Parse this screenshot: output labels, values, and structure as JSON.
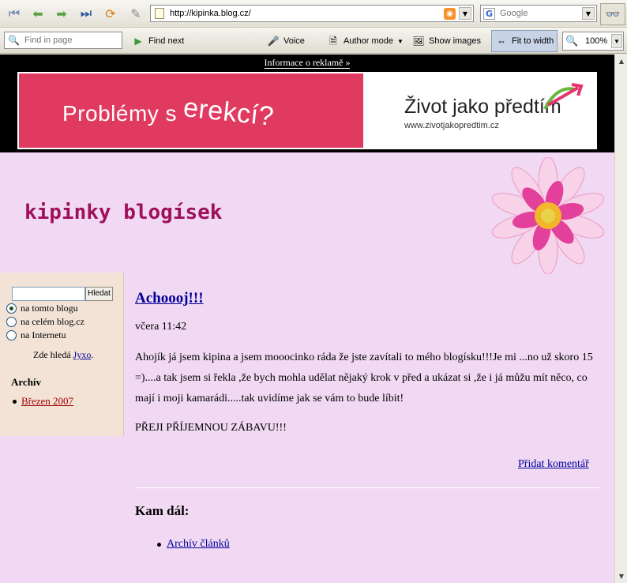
{
  "browser": {
    "url": "http://kipinka.blog.cz/",
    "search_placeholder": "Google",
    "find_placeholder": "Find in page",
    "find_next": "Find next",
    "voice": "Voice",
    "author_mode": "Author mode",
    "show_images": "Show images",
    "fit_to_width": "Fit to width",
    "zoom": "100%"
  },
  "ad": {
    "info_link": "Informace o reklamě »",
    "left_text": "Problémy s",
    "left_emph": "erekcí?",
    "right_title": "Život jako předtím",
    "right_url": "www.zivotjakopredtim.cz"
  },
  "blog": {
    "title": "kipinky blogísek"
  },
  "sidebar": {
    "search_button": "Hledat",
    "scope": [
      "na tomto blogu",
      "na celém blog.cz",
      "na Internetu"
    ],
    "search_by_prefix": "Zde hledá",
    "search_by_link": "Jyxo",
    "search_by_suffix": ".",
    "archive_heading": "Archív",
    "archive_items": [
      "Březen 2007"
    ]
  },
  "post": {
    "title": "Achoooj!!!",
    "date": "včera 11:42",
    "body": "Ahojík já jsem kipina a jsem mooocinko ráda že jste zavítali to mého blogísku!!!Je mi ...no už skoro 15 =)....a tak jsem si řekla ,že bych mohla udělat nějaký krok v před a ukázat si ,že i já můžu mít něco, co mají i moji kamarádi.....tak uvidíme jak se vám to bude líbit!",
    "body2": "PŘEJI PŘÍJEMNOU ZÁBAVU!!!",
    "add_comment": "Přidat komentář"
  },
  "more": {
    "heading": "Kam dál:",
    "items": [
      "Archív článků"
    ]
  },
  "colors": {
    "page_bg": "#f1d9f3",
    "sidebar_bg": "#f2e3d6",
    "title_color": "#a0105a",
    "link_color": "#000099",
    "ad_pink": "#e13a60"
  }
}
